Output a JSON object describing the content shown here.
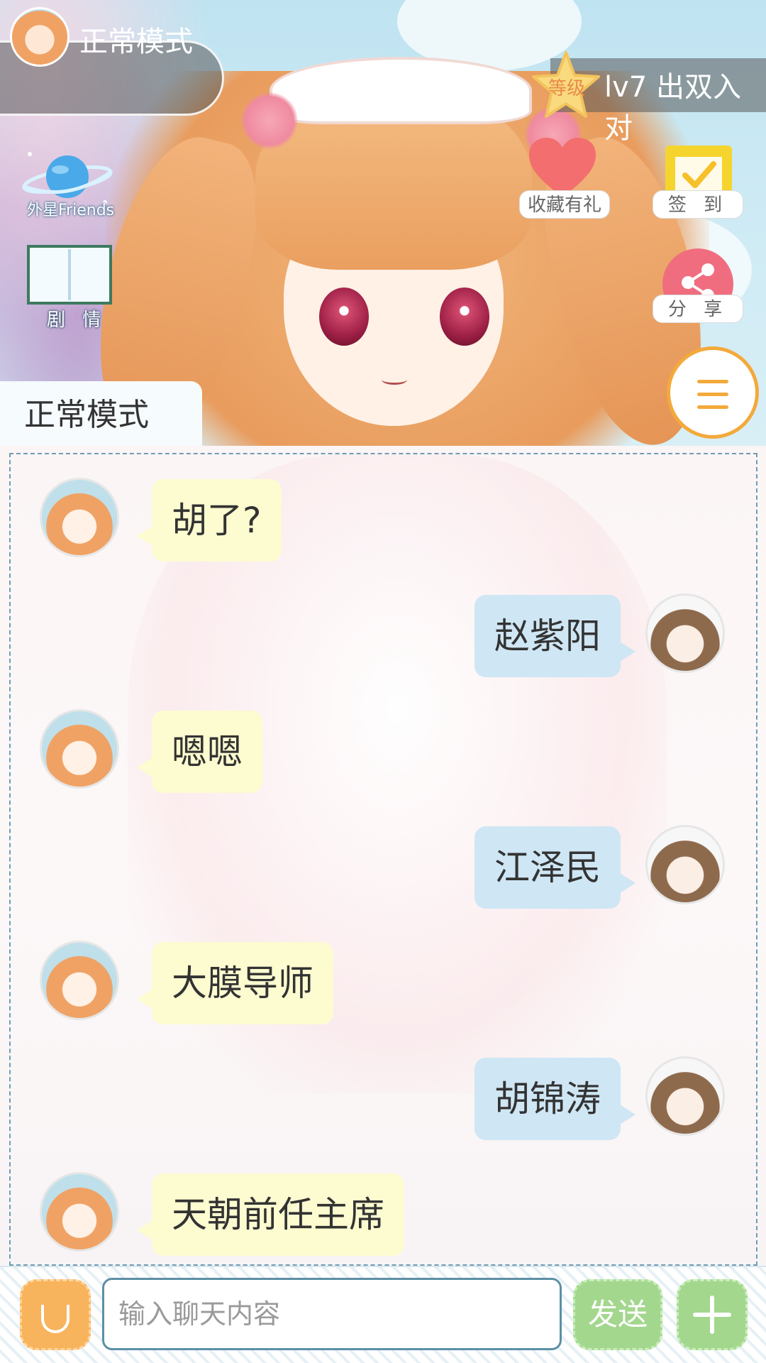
{
  "header": {
    "mode_pill_label": "正常模式",
    "level_badge": "等级",
    "level_text": "lv7 出双入对",
    "mode_tab_label": "正常模式"
  },
  "left_icons": {
    "friends_label": "外星Friends",
    "story_label": "剧 情"
  },
  "right_icons": {
    "favorite_label": "收藏有礼",
    "checkin_label": "签 到",
    "share_label": "分 享",
    "menu_icon": "hamburger-menu-icon"
  },
  "colors": {
    "left_bubble": "#fdfbd0",
    "right_bubble": "#cfe6f4",
    "accent_orange": "#f4a93b",
    "send_green": "#a3d78e"
  },
  "messages": [
    {
      "side": "left",
      "sender": "character",
      "text": "胡了?"
    },
    {
      "side": "right",
      "sender": "user",
      "text": "赵紫阳"
    },
    {
      "side": "left",
      "sender": "character",
      "text": "嗯嗯"
    },
    {
      "side": "right",
      "sender": "user",
      "text": "江泽民"
    },
    {
      "side": "left",
      "sender": "character",
      "text": "大膜导师"
    },
    {
      "side": "right",
      "sender": "user",
      "text": "胡锦涛"
    },
    {
      "side": "left",
      "sender": "character",
      "text": "天朝前任主席"
    }
  ],
  "input": {
    "placeholder": "输入聊天内容",
    "value": "",
    "send_label": "发送"
  }
}
